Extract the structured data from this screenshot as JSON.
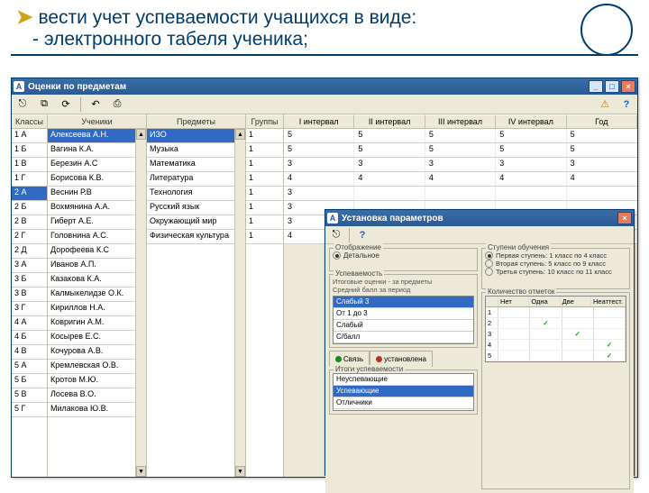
{
  "slide": {
    "line1": "вести учет успеваемости учащихся в виде:",
    "line2": "- электронного табеля ученика;"
  },
  "mainWin": {
    "title": "Оценки по предметам",
    "toolbar_icons": [
      "exit-icon",
      "copy-icon",
      "refresh-icon",
      "undo-icon",
      "print-icon",
      "help-icon"
    ],
    "headers": {
      "classes": "Классы",
      "students": "Ученики",
      "subjects": "Предметы",
      "groups": "Группы",
      "i1": "I интервал",
      "i2": "II интервал",
      "i3": "III интервал",
      "i4": "IV интервал",
      "year": "Год"
    },
    "classes": [
      "1 А",
      "1 Б",
      "1 В",
      "1 Г",
      "2 А",
      "2 Б",
      "2 В",
      "2 Г",
      "2 Д",
      "3 А",
      "3 Б",
      "3 В",
      "3 Г",
      "4 А",
      "4 Б",
      "4 В",
      "5 А",
      "5 Б",
      "5 В",
      "5 Г"
    ],
    "classes_selected": 4,
    "students": [
      "Алексеева А.Н.",
      "Вагина К.А.",
      "Березин А.С",
      "Борисова К.В.",
      "Веснин Р.В",
      "Вохмянина А.А.",
      "Гиберт А.Е.",
      "Головнина А.С.",
      "Дорофеева К.С",
      "Иванов А.П.",
      "Казакова К.А.",
      "Калмыкелидзе О.К.",
      "Кириллов Н.А.",
      "Ковригин А.М.",
      "Косырев Е.С.",
      "Кочурова А.В.",
      "Кремлевская О.В.",
      "Кротов М.Ю.",
      "Лосева В.О.",
      "Милакова Ю.В."
    ],
    "students_selected": 0,
    "subjects": [
      "ИЗО",
      "Музыка",
      "Математика",
      "Литература",
      "Технология",
      "Русский язык",
      "Окружающий мир",
      "Физическая культура"
    ],
    "subjects_selected": 0,
    "groups": [
      "1",
      "1",
      "1",
      "1",
      "1",
      "1",
      "1",
      "1"
    ],
    "grades": [
      [
        "5",
        "5",
        "5",
        "5",
        "5"
      ],
      [
        "5",
        "5",
        "5",
        "5",
        "5"
      ],
      [
        "3",
        "3",
        "3",
        "3",
        "3"
      ],
      [
        "4",
        "4",
        "4",
        "4",
        "4"
      ],
      [
        "3",
        "",
        "",
        "",
        ""
      ],
      [
        "3",
        "",
        "",
        "",
        ""
      ],
      [
        "3",
        "",
        "",
        "",
        ""
      ],
      [
        "4",
        "",
        "",
        "",
        ""
      ]
    ]
  },
  "dialog": {
    "title": "Установка параметров",
    "fieldset_display": "Отображение",
    "display_option": "Детальное",
    "fieldset_study": "Ступени обучения",
    "study_options": [
      {
        "label": "Первая ступень: 1 класс по 4 класс",
        "on": true
      },
      {
        "label": "Вторая ступень: 5 класс по 9 класс",
        "on": false
      },
      {
        "label": "Третья ступень: 10 класс по 11 класс",
        "on": false
      }
    ],
    "uspev_title": "Успеваемость",
    "uspev_lines": [
      "Итоговые оценки - за предметы",
      "Средний балл за период"
    ],
    "levels": [
      "Слабый 3",
      "От 1 до 3",
      "Слабый",
      "С/балл"
    ],
    "levels_selected": 0,
    "tab_save": "Связь",
    "tab_set": "установлена",
    "itogi_title": "Итоги успеваемости",
    "itogi_items": [
      "Неуспевающие",
      "Успевающие",
      "Отличники"
    ],
    "itogi_selected": 1,
    "quantity_title": "Количество отметок",
    "qty_headers": [
      "№",
      "Нет",
      "Одна",
      "Две",
      "Неаттест."
    ],
    "qty_rows": [
      [
        "1",
        "",
        "",
        "",
        ""
      ],
      [
        "2",
        "",
        "✓",
        "",
        ""
      ],
      [
        "3",
        "",
        "",
        "✓",
        ""
      ],
      [
        "4",
        "",
        "",
        "",
        "✓"
      ],
      [
        "5",
        "",
        "",
        "",
        "✓"
      ]
    ]
  }
}
